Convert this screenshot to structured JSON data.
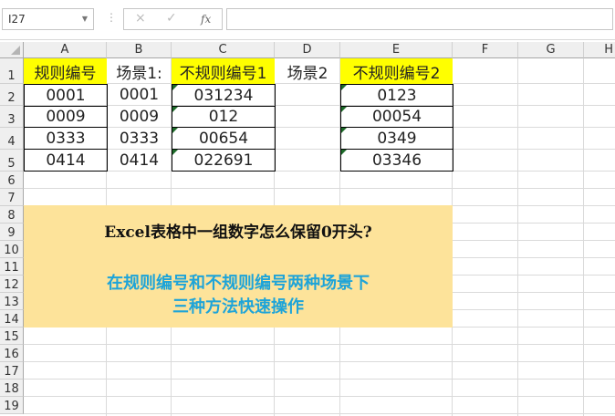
{
  "formula_bar": {
    "name_box": "I27",
    "cancel_icon": "×",
    "enter_icon": "✓",
    "fx_label": "fx",
    "formula": ""
  },
  "columns": [
    "A",
    "B",
    "C",
    "D",
    "E",
    "F",
    "G",
    "H"
  ],
  "rows": [
    "1",
    "2",
    "3",
    "4",
    "5",
    "6",
    "7",
    "8",
    "9",
    "10",
    "11",
    "12",
    "13",
    "14",
    "15",
    "16",
    "17",
    "18",
    "19"
  ],
  "cells": {
    "A1": "规则编号",
    "B1": "场景1:",
    "C1": "不规则编号1",
    "D1": "场景2",
    "E1": "不规则编号2",
    "A": [
      "0001",
      "0009",
      "0333",
      "0414"
    ],
    "B": [
      "0001",
      "0009",
      "0333",
      "0414"
    ],
    "C": [
      "031234",
      "012",
      "00654",
      "022691"
    ],
    "E": [
      "0123",
      "00054",
      "0349",
      "03346"
    ]
  },
  "banner": {
    "title": "Excel表格中一组数字怎么保留0开头?",
    "line1": "在规则编号和不规则编号两种场景下",
    "line2": "三种方法快速操作"
  },
  "colors": {
    "header_fill": "#ffff00",
    "banner_fill": "#fde39a",
    "subtitle": "#1ea4d8",
    "error_triangle": "#1e6b2a"
  }
}
